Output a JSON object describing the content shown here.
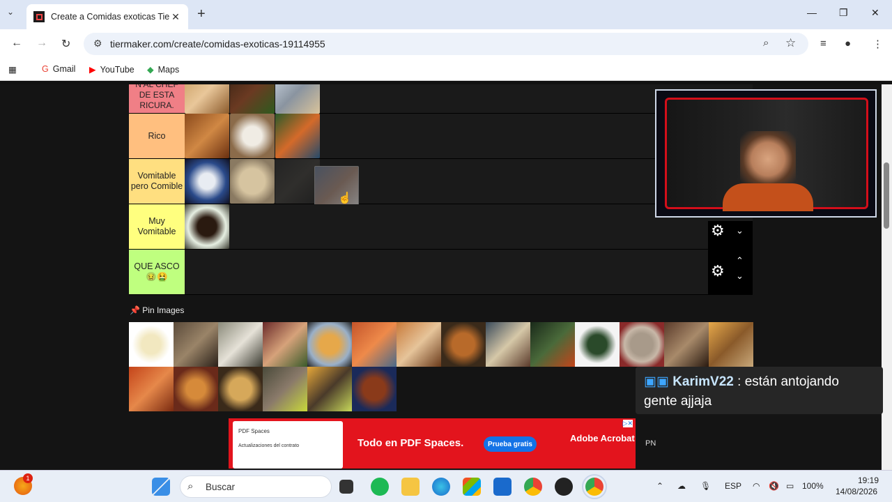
{
  "browser": {
    "tab_title": "Create a Comidas exoticas Tier List",
    "new_tab": "+",
    "url": "tiermaker.com/create/comidas-exoticas-19114955",
    "bookmarks": [
      {
        "label": "Gmail",
        "icon": "gmail-icon"
      },
      {
        "label": "YouTube",
        "icon": "youtube-icon"
      },
      {
        "label": "Maps",
        "icon": "maps-icon"
      }
    ]
  },
  "tiers": [
    {
      "label": "N AL CHEF DE ESTA RICURA.",
      "color": "#f07f86",
      "items": 3
    },
    {
      "label": "Rico",
      "color": "#ffbf7f",
      "items": 3
    },
    {
      "label": "Vomitable pero Comible",
      "color": "#ffdf80",
      "items": 4
    },
    {
      "label": "Muy Vomitable",
      "color": "#ffff7f",
      "items": 1
    },
    {
      "label": "QUE ASCO 🤢🤮",
      "color": "#bfff7f",
      "items": 0
    }
  ],
  "pin_images_label": "Pin Images",
  "pool_count": 22,
  "chat": {
    "user": "KarimV22",
    "separator": " : ",
    "message": "están antojando gente ajjaja"
  },
  "ad": {
    "headline": "Todo en PDF Spaces.",
    "button": "Prueba gratis",
    "brand": "Adobe Acrobat",
    "thumb_title": "PDF Spaces",
    "thumb_text": "Actualizaciones del contrato"
  },
  "pn_label": "PN",
  "taskbar": {
    "search_placeholder": "Buscar",
    "lang": "ESP",
    "battery": "100%",
    "time": "19:19",
    "date": "14/08/2026",
    "notification_badge": "1"
  }
}
